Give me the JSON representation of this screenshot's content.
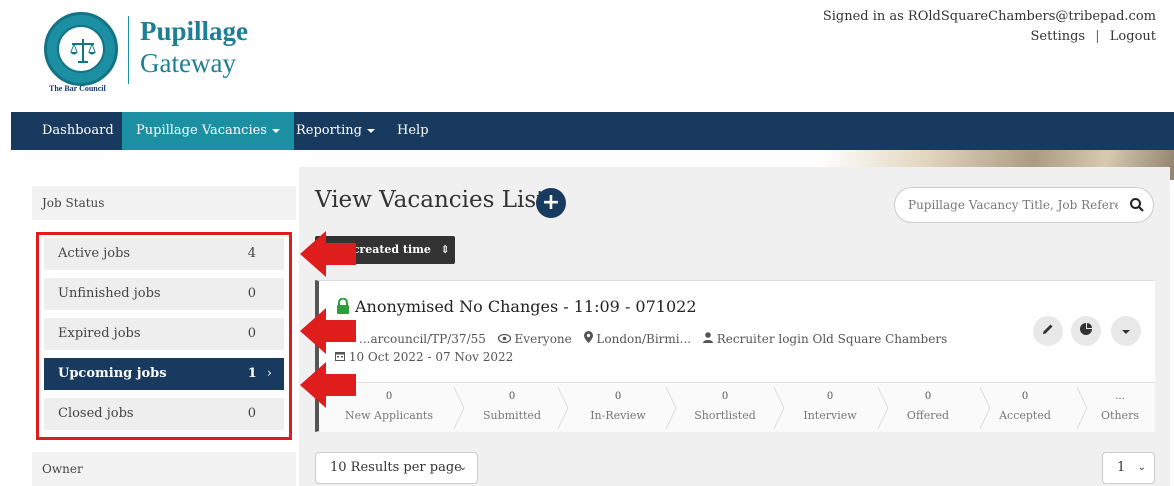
{
  "header": {
    "logo_title_line1": "Pupillage",
    "logo_title_line2": "Gateway",
    "logo_caption": "The Bar Council",
    "signed_in_text": "Signed in as ROldSquareChambers@tribepad.com",
    "settings_label": "Settings",
    "separator": "|",
    "logout_label": "Logout"
  },
  "nav": {
    "items": [
      {
        "label": "Dashboard"
      },
      {
        "label": "Pupillage Vacancies",
        "active": true,
        "dropdown": true
      },
      {
        "label": "Reporting",
        "dropdown": true
      },
      {
        "label": "Help"
      }
    ]
  },
  "sidebar": {
    "job_status_heading": "Job Status",
    "items": [
      {
        "label": "Active jobs",
        "count": "4"
      },
      {
        "label": "Unfinished jobs",
        "count": "0"
      },
      {
        "label": "Expired jobs",
        "count": "0"
      },
      {
        "label": "Upcoming jobs",
        "count": "1",
        "active": true,
        "chevron": "›"
      },
      {
        "label": "Closed jobs",
        "count": "0"
      }
    ],
    "owner_heading": "Owner"
  },
  "main": {
    "title": "View Vacancies List",
    "add_symbol": "+",
    "search_placeholder": "Pupillage Vacancy Title, Job Reference",
    "sort_label": "...y created time",
    "sort_icon": "⇕"
  },
  "vacancy": {
    "title": "Anonymised No Changes - 11:09 - 071022",
    "reference": "...arcouncil/TP/37/55",
    "visibility": "Everyone",
    "location": "London/Birmi...",
    "recruiter": "Recruiter login Old Square Chambers",
    "dates": "10 Oct 2022 - 07 Nov 2022",
    "stages": [
      {
        "count": "0",
        "label": "New Applicants"
      },
      {
        "count": "0",
        "label": "Submitted"
      },
      {
        "count": "0",
        "label": "In-Review"
      },
      {
        "count": "0",
        "label": "Shortlisted"
      },
      {
        "count": "0",
        "label": "Interview"
      },
      {
        "count": "0",
        "label": "Offered"
      },
      {
        "count": "0",
        "label": "Accepted"
      },
      {
        "count": "...",
        "label": "Others"
      }
    ]
  },
  "pagination": {
    "results_per_page": "10 Results per page",
    "page": "1"
  },
  "colors": {
    "navy": "#173a5e",
    "teal": "#1d8fa3",
    "highlight_red": "#e01d1d"
  }
}
